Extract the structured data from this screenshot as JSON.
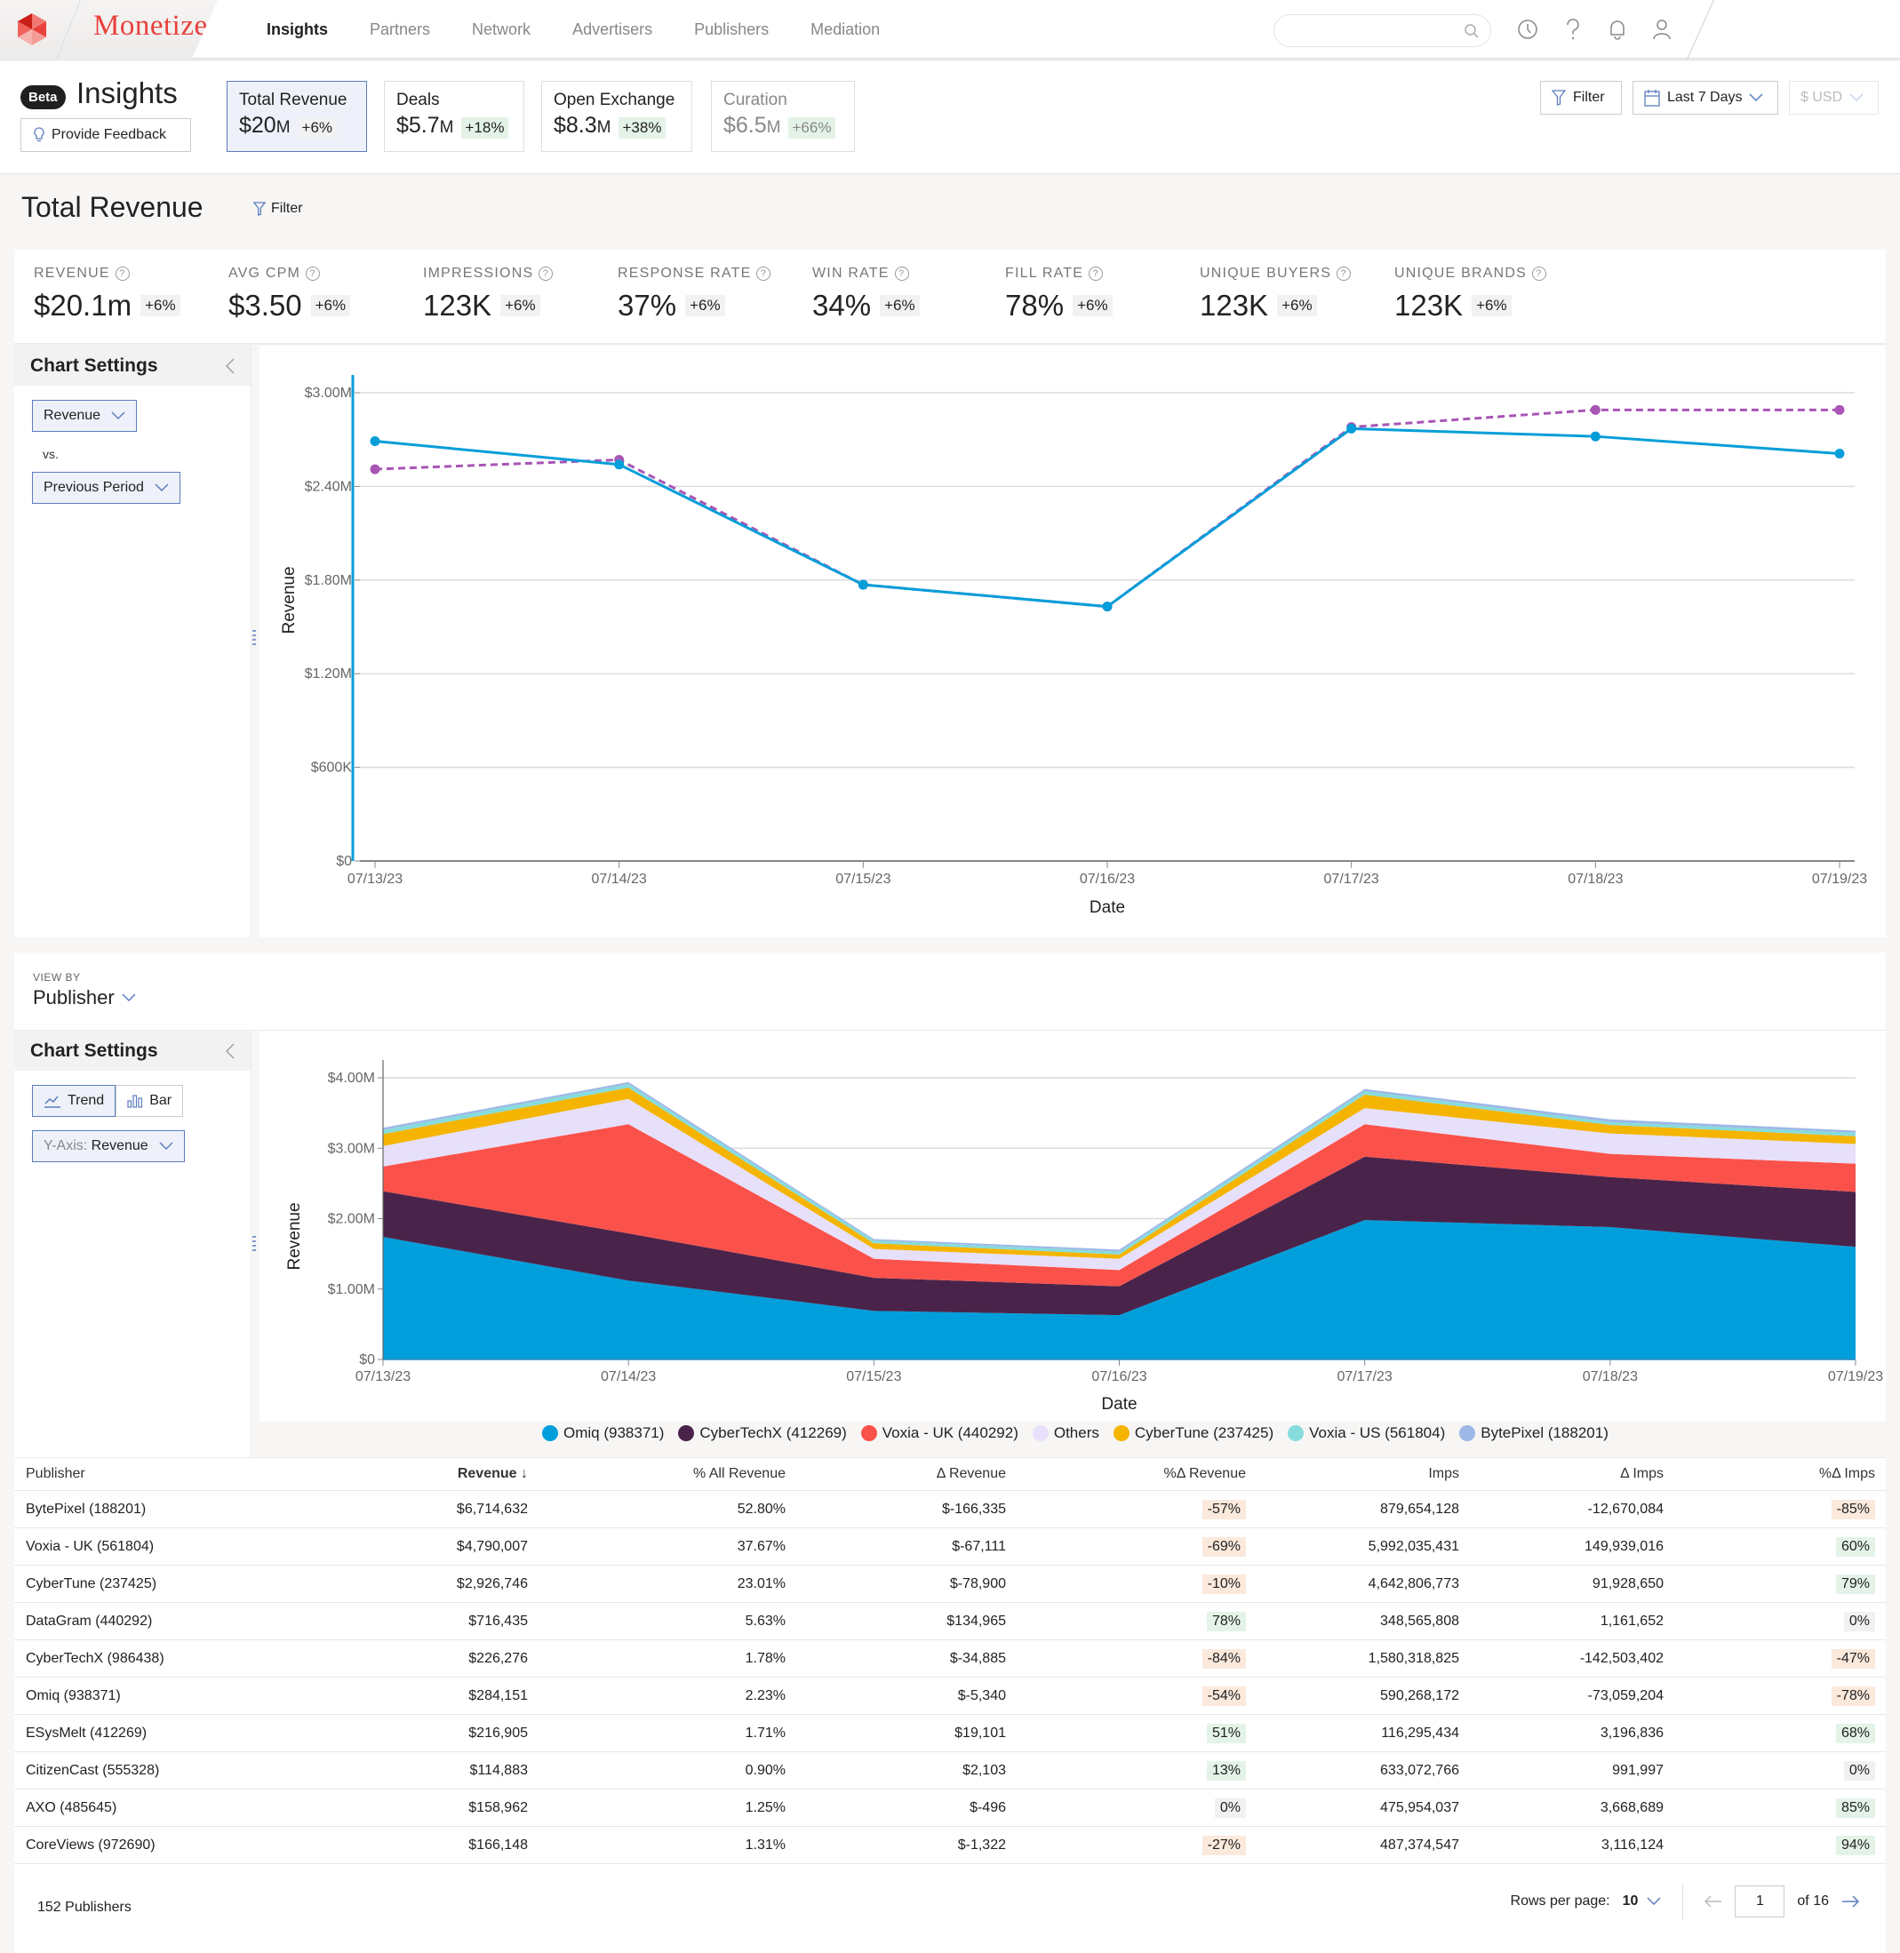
{
  "app": {
    "brand": "Monetize",
    "nav": [
      "Insights",
      "Partners",
      "Network",
      "Advertisers",
      "Publishers",
      "Mediation"
    ],
    "active_nav": "Insights",
    "search_placeholder": ""
  },
  "header": {
    "beta_badge": "Beta",
    "title": "Insights",
    "feedback_label": "Provide Feedback",
    "cards": [
      {
        "label": "Total Revenue",
        "value": "$20",
        "unit": "M",
        "change": "+6%"
      },
      {
        "label": "Deals",
        "value": "$5.7",
        "unit": "M",
        "change": "+18%"
      },
      {
        "label": "Open Exchange",
        "value": "$8.3",
        "unit": "M",
        "change": "+38%"
      },
      {
        "label": "Curation",
        "value": "$6.5",
        "unit": "M",
        "change": "+66%"
      }
    ],
    "filter_label": "Filter",
    "date_range": "Last 7 Days",
    "currency": "$ USD"
  },
  "section": {
    "title": "Total Revenue",
    "filter_label": "Filter",
    "metrics": [
      {
        "label": "REVENUE",
        "value": "$20.1m",
        "change": "+6%"
      },
      {
        "label": "AVG CPM",
        "value": "$3.50",
        "change": "+6%"
      },
      {
        "label": "IMPRESSIONS",
        "value": "123K",
        "change": "+6%"
      },
      {
        "label": "RESPONSE RATE",
        "value": "37%",
        "change": "+6%"
      },
      {
        "label": "WIN RATE",
        "value": "34%",
        "change": "+6%"
      },
      {
        "label": "FILL RATE",
        "value": "78%",
        "change": "+6%"
      },
      {
        "label": "UNIQUE BUYERS",
        "value": "123K",
        "change": "+6%"
      },
      {
        "label": "UNIQUE BRANDS",
        "value": "123K",
        "change": "+6%"
      }
    ]
  },
  "chart_settings_1": {
    "title": "Chart Settings",
    "metric": "Revenue",
    "vs_label": "vs.",
    "compare": "Previous Period"
  },
  "view_by": {
    "label": "VIEW BY",
    "value": "Publisher"
  },
  "chart_settings_2": {
    "title": "Chart Settings",
    "trend_label": "Trend",
    "bar_label": "Bar",
    "yaxis_prefix": "Y-Axis:",
    "yaxis_value": "Revenue"
  },
  "colors": {
    "accent": "#5b7cbf",
    "brand": "#e8413b",
    "current": "#069ed9",
    "previous": "#a855b5"
  },
  "chart_data": [
    {
      "type": "line",
      "title": "",
      "xlabel": "Date",
      "ylabel": "Revenue",
      "x": [
        "07/13/23",
        "07/14/23",
        "07/15/23",
        "07/16/23",
        "07/17/23",
        "07/18/23",
        "07/19/23"
      ],
      "yticks": [
        "$0",
        "$600K",
        "$1.20M",
        "$1.80M",
        "$2.40M",
        "$3.00M"
      ],
      "ylim": [
        0,
        3000000
      ],
      "grid": true,
      "series": [
        {
          "name": "Revenue",
          "style": "solid",
          "color": "#069ed9",
          "values": [
            2690000,
            2540000,
            1770000,
            1630000,
            2770000,
            2720000,
            2610000
          ]
        },
        {
          "name": "Previous Period",
          "style": "dashed",
          "color": "#a855b5",
          "values": [
            2510000,
            2570000,
            1770000,
            1630000,
            2780000,
            2890000,
            2890000
          ]
        }
      ]
    },
    {
      "type": "area",
      "stacked": true,
      "title": "",
      "xlabel": "Date",
      "ylabel": "Revenue",
      "x": [
        "07/13/23",
        "07/14/23",
        "07/15/23",
        "07/16/23",
        "07/17/23",
        "07/18/23",
        "07/19/23"
      ],
      "yticks": [
        "$0",
        "$1.00M",
        "$2.00M",
        "$3.00M",
        "$4.00M"
      ],
      "ylim": [
        0,
        4000000
      ],
      "grid": true,
      "legend_position": "bottom",
      "series": [
        {
          "name": "Omiq (938371)",
          "color": "#009fdb",
          "values": [
            1740000,
            1120000,
            690000,
            630000,
            1980000,
            1880000,
            1600000
          ]
        },
        {
          "name": "CyberTechX (412269)",
          "color": "#4a234b",
          "values": [
            650000,
            670000,
            470000,
            410000,
            900000,
            710000,
            780000
          ]
        },
        {
          "name": "Voxia - UK (440292)",
          "color": "#fa524a",
          "values": [
            350000,
            1550000,
            270000,
            230000,
            460000,
            330000,
            400000
          ]
        },
        {
          "name": "Others",
          "color": "#e7e0fb",
          "values": [
            290000,
            360000,
            140000,
            160000,
            230000,
            290000,
            280000
          ]
        },
        {
          "name": "CyberTune (237425)",
          "color": "#f4b400",
          "values": [
            170000,
            160000,
            80000,
            60000,
            190000,
            120000,
            110000
          ]
        },
        {
          "name": "Voxia - US (561804)",
          "color": "#86dcdc",
          "values": [
            60000,
            50000,
            40000,
            40000,
            50000,
            40000,
            50000
          ]
        },
        {
          "name": "BytePixel (188201)",
          "color": "#9db8e6",
          "values": [
            30000,
            30000,
            20000,
            30000,
            30000,
            40000,
            30000
          ]
        }
      ]
    }
  ],
  "table": {
    "columns": [
      "Publisher",
      "Revenue",
      "% All Revenue",
      "Δ Revenue",
      "%Δ Revenue",
      "Imps",
      "Δ Imps",
      "%Δ Imps"
    ],
    "sort_column": "Revenue",
    "rows": [
      [
        "BytePixel (188201)",
        "$6,714,632",
        "52.80%",
        "$-166,335",
        "-57%",
        "879,654,128",
        "-12,670,084",
        "-85%"
      ],
      [
        "Voxia - UK (561804)",
        "$4,790,007",
        "37.67%",
        "$-67,111",
        "-69%",
        "5,992,035,431",
        "149,939,016",
        "60%"
      ],
      [
        "CyberTune (237425)",
        "$2,926,746",
        "23.01%",
        "$-78,900",
        "-10%",
        "4,642,806,773",
        "91,928,650",
        "79%"
      ],
      [
        "DataGram (440292)",
        "$716,435",
        "5.63%",
        "$134,965",
        "78%",
        "348,565,808",
        "1,161,652",
        "0%"
      ],
      [
        "CyberTechX (986438)",
        "$226,276",
        "1.78%",
        "$-34,885",
        "-84%",
        "1,580,318,825",
        "-142,503,402",
        "-47%"
      ],
      [
        "Omiq (938371)",
        "$284,151",
        "2.23%",
        "$-5,340",
        "-54%",
        "590,268,172",
        "-73,059,204",
        "-78%"
      ],
      [
        "ESysMelt (412269)",
        "$216,905",
        "1.71%",
        "$19,101",
        "51%",
        "116,295,434",
        "3,196,836",
        "68%"
      ],
      [
        "CitizenCast (555328)",
        "$114,883",
        "0.90%",
        "$2,103",
        "13%",
        "633,072,766",
        "991,997",
        "0%"
      ],
      [
        "AXO (485645)",
        "$158,962",
        "1.25%",
        "$-496",
        "0%",
        "475,954,037",
        "3,668,689",
        "85%"
      ],
      [
        "CoreViews (972690)",
        "$166,148",
        "1.31%",
        "$-1,322",
        "-27%",
        "487,374,547",
        "3,116,124",
        "94%"
      ]
    ],
    "total_label": "152 Publishers",
    "rows_per_page_label": "Rows per page:",
    "rows_per_page": "10",
    "page": "1",
    "page_total": "of 16"
  }
}
